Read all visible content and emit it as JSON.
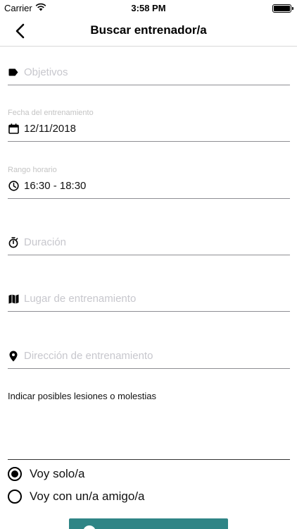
{
  "status_bar": {
    "carrier": "Carrier",
    "time": "3:58 PM"
  },
  "nav": {
    "title": "Buscar entrenador/a"
  },
  "form": {
    "objectives": {
      "placeholder": "Objetivos",
      "icon": "tag-icon"
    },
    "date": {
      "label": "Fecha del entrenamiento",
      "value": "12/11/2018",
      "icon": "calendar-icon"
    },
    "time_range": {
      "label": "Rango horario",
      "value": "16:30 - 18:30",
      "icon": "clock-icon"
    },
    "duration": {
      "placeholder": "Duración",
      "icon": "stopwatch-icon"
    },
    "place": {
      "placeholder": "Lugar de entrenamiento",
      "icon": "map-icon"
    },
    "address": {
      "placeholder": "Dirección de entrenamiento",
      "icon": "location-pin-icon"
    },
    "injuries": {
      "label": "Indicar posibles lesiones o molestias"
    },
    "company": {
      "options": [
        {
          "label": "Voy solo/a",
          "selected": true
        },
        {
          "label": "Voy con un/a amigo/a",
          "selected": false
        }
      ]
    }
  },
  "colors": {
    "accent": "#2f8586",
    "placeholder": "#c7c7cd",
    "floating_label": "#c4c4c4"
  }
}
